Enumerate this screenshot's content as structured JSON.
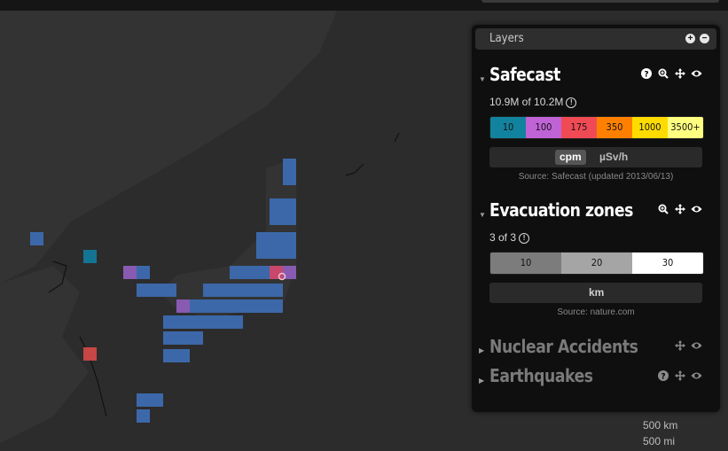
{
  "colors": {
    "cell_blue": "#3d6bb0",
    "cell_purple": "#8d5db8",
    "cell_teal": "#13789a",
    "cell_red": "#d04848",
    "panel_bg": "#0f0f0f",
    "scale": [
      "#12839e",
      "#c063d6",
      "#f04b55",
      "#ff8000",
      "#ffdc00",
      "#ffff80"
    ],
    "zones": [
      "#7c7c7c",
      "#a5a5a5",
      "#ffffff"
    ]
  },
  "panel": {
    "title": "Layers",
    "add_icon": "plus-circle-icon",
    "remove_icon": "minus-circle-icon"
  },
  "safecast": {
    "title": "Safecast",
    "count": "10.9M of 10.2M",
    "scale": [
      "10",
      "100",
      "175",
      "350",
      "1000",
      "3500+"
    ],
    "units": [
      "cpm",
      "µSv/h"
    ],
    "selected_unit": "cpm",
    "source": "Source: Safecast (updated 2013/06/13)",
    "icons": [
      "help-icon",
      "zoom-icon",
      "move-icon",
      "eye-icon"
    ]
  },
  "evacuation": {
    "title": "Evacuation zones",
    "count": "3 of 3",
    "zones": [
      "10",
      "20",
      "30"
    ],
    "unit": "km",
    "source": "Source: nature.com",
    "icons": [
      "zoom-icon",
      "move-icon",
      "eye-icon"
    ]
  },
  "nuclear": {
    "title": "Nuclear Accidents",
    "icons": [
      "move-icon",
      "eye-icon"
    ]
  },
  "earthquakes": {
    "title": "Earthquakes",
    "icons": [
      "help-icon",
      "move-icon",
      "eye-icon"
    ]
  },
  "map_scale": {
    "km": "500 km",
    "mi": "500 mi"
  }
}
